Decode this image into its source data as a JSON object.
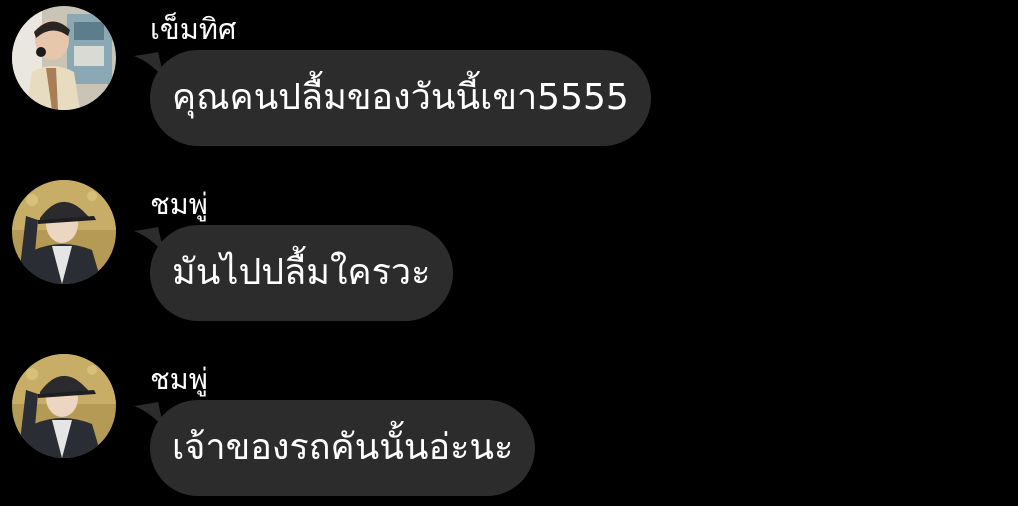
{
  "messages": [
    {
      "sender": "เข็มทิศ",
      "text": "คุณคนปลื้มของวันนี้เขา5555",
      "avatar": "avatar-photo-man-on-phone"
    },
    {
      "sender": "ชมพู่",
      "text": "มันไปปลื้มใครวะ",
      "avatar": "avatar-photo-man-in-cap"
    },
    {
      "sender": "ชมพู่",
      "text": "เจ้าของรถคันนั้นอ่ะนะ",
      "avatar": "avatar-photo-man-in-cap"
    }
  ],
  "colors": {
    "background": "#000000",
    "bubble": "#2c2c2c",
    "text": "#ffffff"
  }
}
